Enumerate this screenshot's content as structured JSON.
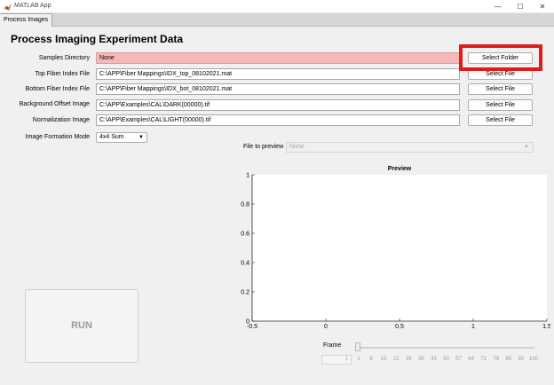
{
  "window": {
    "title": "MATLAB App",
    "controls": {
      "minimize": "—",
      "maximize": "☐",
      "close": "✕"
    }
  },
  "tabs": [
    {
      "label": "Process Images",
      "active": true
    }
  ],
  "page": {
    "title": "Process Imaging Experiment Data"
  },
  "form": {
    "rows": [
      {
        "label": "Samples Directory",
        "value": "None",
        "button": "Select Folder",
        "invalid": true
      },
      {
        "label": "Top Fiber Index File",
        "value": "C:\\APP\\Fiber Mappings\\IDX_top_08102021.mat",
        "button": "Select File"
      },
      {
        "label": "Bottom Fiber Index File",
        "value": "C:\\APP\\Fiber Mappings\\IDX_bot_08102021.mat",
        "button": "Select File"
      },
      {
        "label": "Background Offset Image",
        "value": "C:\\APP\\Examples\\CAL\\DARK(00000).tif",
        "button": "Select File"
      },
      {
        "label": "Normalization Image",
        "value": "C:\\APP\\Examples\\CAL\\LIGHT(00000).tif",
        "button": "Select File"
      }
    ],
    "mode": {
      "label": "Image Formation Mode",
      "value": "4x4 Sum"
    }
  },
  "preview": {
    "file_label": "File to preview",
    "file_value": "None",
    "title": "Preview"
  },
  "chart_data": {
    "type": "line",
    "title": "Preview",
    "xlim": [
      -0.5,
      1.5
    ],
    "ylim": [
      0,
      1
    ],
    "x_ticks": [
      "-0.5",
      "0",
      "0.5",
      "1",
      "1.5"
    ],
    "y_ticks": [
      "0",
      "0.2",
      "0.4",
      "0.6",
      "0.8",
      "1"
    ],
    "series": [],
    "grid": false
  },
  "run_button": {
    "label": "RUN"
  },
  "frame": {
    "label": "Frame",
    "value": "1",
    "ticks": [
      "1",
      "8",
      "15",
      "22",
      "29",
      "36",
      "43",
      "50",
      "57",
      "64",
      "71",
      "78",
      "85",
      "92",
      "100"
    ]
  }
}
